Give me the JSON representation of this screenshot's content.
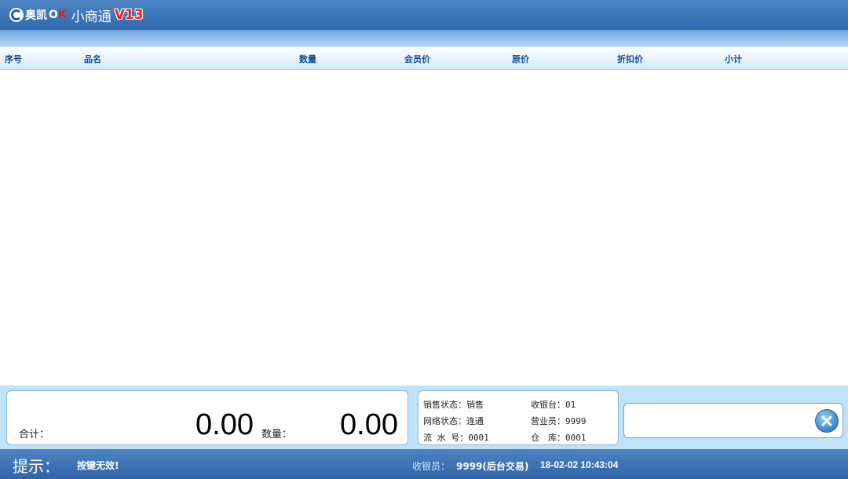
{
  "titlebar": {
    "brand": "奥凯",
    "brand_ok": "O",
    "brand_ok_c": "K",
    "product": "小商通",
    "version": "V13"
  },
  "table": {
    "columns": [
      "序号",
      "品名",
      "数量",
      "会员价",
      "原价",
      "折扣价",
      "小计"
    ],
    "rows": []
  },
  "totals": {
    "total_label": "合计：",
    "total_amount": "0.00",
    "qty_label": "数量：",
    "qty_amount": "0.00"
  },
  "info": {
    "sale_status_label": "销售状态：",
    "sale_status_value": "销售",
    "register_label": "收银台：",
    "register_value": "01",
    "network_status_label": "网络状态：",
    "network_status_value": "连通",
    "clerk_label": "营业员：",
    "clerk_value": "9999",
    "serial_label": "流 水 号：",
    "serial_value": "0001",
    "warehouse_label": "仓　库：",
    "warehouse_value": "0001"
  },
  "input": {
    "value": "",
    "placeholder": ""
  },
  "statusbar": {
    "hint_label": "提示：",
    "hint_text": "按键无效!",
    "cashier_label": "收银员：",
    "cashier_value": "9999(后台交易)",
    "datetime": "18-02-02 10:43:04"
  },
  "icons": {
    "logo": "aokai-logo-icon",
    "clear": "close-circle-icon"
  },
  "colors": {
    "titlebar": "#3a73b6",
    "header_text": "#14508f",
    "bottom_area": "#bfe3f9",
    "version_red": "#e82020"
  }
}
